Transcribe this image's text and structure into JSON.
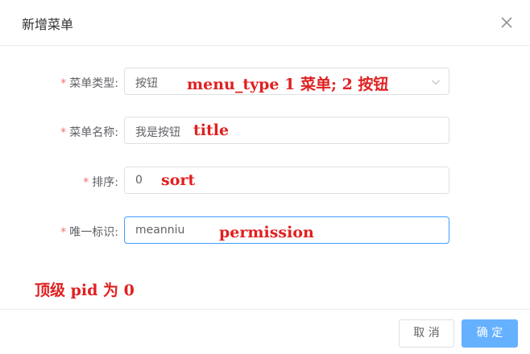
{
  "dialog": {
    "title": "新增菜单"
  },
  "form": {
    "menu_type": {
      "label": "菜单类型:",
      "value": "按钮",
      "annotation": "menu_type  1 菜单;  2 按钮"
    },
    "menu_name": {
      "label": "菜单名称:",
      "value": "我是按钮",
      "annotation": "title"
    },
    "sort": {
      "label": "排序:",
      "value": "0",
      "annotation": "sort"
    },
    "permission": {
      "label": "唯一标识:",
      "value": "meanniu",
      "annotation": "permission"
    }
  },
  "note": "顶级 pid   为 0",
  "footer": {
    "cancel_label": "取 消",
    "confirm_label": "确 定"
  },
  "colors": {
    "required": "#f56c6c",
    "annotation": "#e02020",
    "primary_light": "#66b1ff",
    "focus_border": "#409eff"
  },
  "icons": {
    "close": "close-icon",
    "dropdown": "chevron-down-icon"
  }
}
